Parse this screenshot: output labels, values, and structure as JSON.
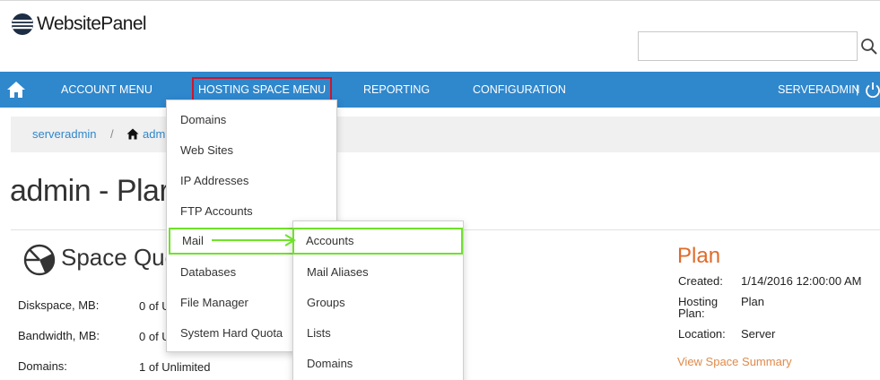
{
  "app": {
    "logo_text": "WebsitePanel"
  },
  "search": {
    "value": "",
    "placeholder": "",
    "button_icon": "search-icon"
  },
  "navbar": {
    "home_icon": "home-icon",
    "items": [
      "ACCOUNT MENU",
      "HOSTING SPACE MENU",
      "REPORTING",
      "CONFIGURATION"
    ],
    "highlighted_item": "HOSTING SPACE MENU",
    "user": "SERVERADMIN",
    "separator": "|",
    "logout_icon": "power-icon",
    "background": "#2f87cc"
  },
  "breadcrumb": {
    "items": [
      "serveradmin",
      "adm"
    ],
    "separator": "/"
  },
  "page": {
    "title": "admin - Plar"
  },
  "quotas": {
    "title": "Space Quo",
    "rows": [
      {
        "label": "Diskspace, MB:",
        "value": "0 of U"
      },
      {
        "label": "Bandwidth, MB:",
        "value": "0 of U"
      },
      {
        "label": "Domains:",
        "value": "1 of Unlimited"
      }
    ]
  },
  "plan": {
    "title": "Plan",
    "created_label": "Created:",
    "created_value": "1/14/2016 12:00:00 AM",
    "hosting_plan_label_1": "Hosting",
    "hosting_plan_label_2": "Plan:",
    "hosting_plan_value": "Plan",
    "location_label": "Location:",
    "location_value": "Server",
    "summary_link": "View Space Summary",
    "title_color": "#e06b2a"
  },
  "hosting_menu": {
    "items": [
      "Domains",
      "Web Sites",
      "IP Addresses",
      "FTP Accounts",
      "Mail",
      "Databases",
      "File Manager",
      "System Hard Quota"
    ],
    "highlighted_item": "Mail"
  },
  "mail_submenu": {
    "items": [
      "Accounts",
      "Mail Aliases",
      "Groups",
      "Lists",
      "Domains"
    ],
    "highlighted_item": "Accounts"
  },
  "annotation_colors": {
    "red_box": "#d1142a",
    "green_box": "#6fe22a"
  }
}
